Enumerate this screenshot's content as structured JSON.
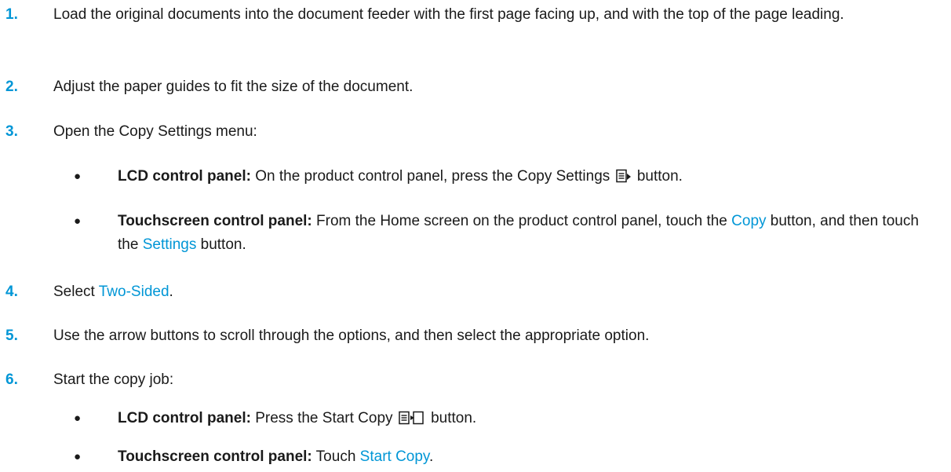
{
  "accent_color": "#0096d6",
  "steps": [
    {
      "num": "1.",
      "text": "Load the original documents into the document feeder with the first page facing up, and with the top of the page leading."
    },
    {
      "num": "2.",
      "text": "Adjust the paper guides to fit the size of the document."
    },
    {
      "num": "3.",
      "text": "Open the Copy Settings menu:",
      "bullets": [
        {
          "bullet": "●",
          "label": "LCD control panel:",
          "pre": " On the product control panel, press the Copy Settings ",
          "icon": "copy-settings-icon",
          "post": " button."
        },
        {
          "bullet": "●",
          "label": "Touchscreen control panel:",
          "pre": " From the Home screen on the product control panel, touch the ",
          "link1": "Copy",
          "mid": " button, and then touch the ",
          "link2": "Settings",
          "post": " button."
        }
      ]
    },
    {
      "num": "4.",
      "pre": "Select ",
      "link": "Two-Sided",
      "post": "."
    },
    {
      "num": "5.",
      "text": "Use the arrow buttons to scroll through the options, and then select the appropriate option."
    },
    {
      "num": "6.",
      "text": "Start the copy job:",
      "bullets": [
        {
          "bullet": "●",
          "label": "LCD control panel:",
          "pre": " Press the Start Copy ",
          "icon": "start-copy-icon",
          "post": " button."
        },
        {
          "bullet": "●",
          "label": "Touchscreen control panel:",
          "pre": " Touch ",
          "link": "Start Copy",
          "post": "."
        }
      ]
    }
  ]
}
